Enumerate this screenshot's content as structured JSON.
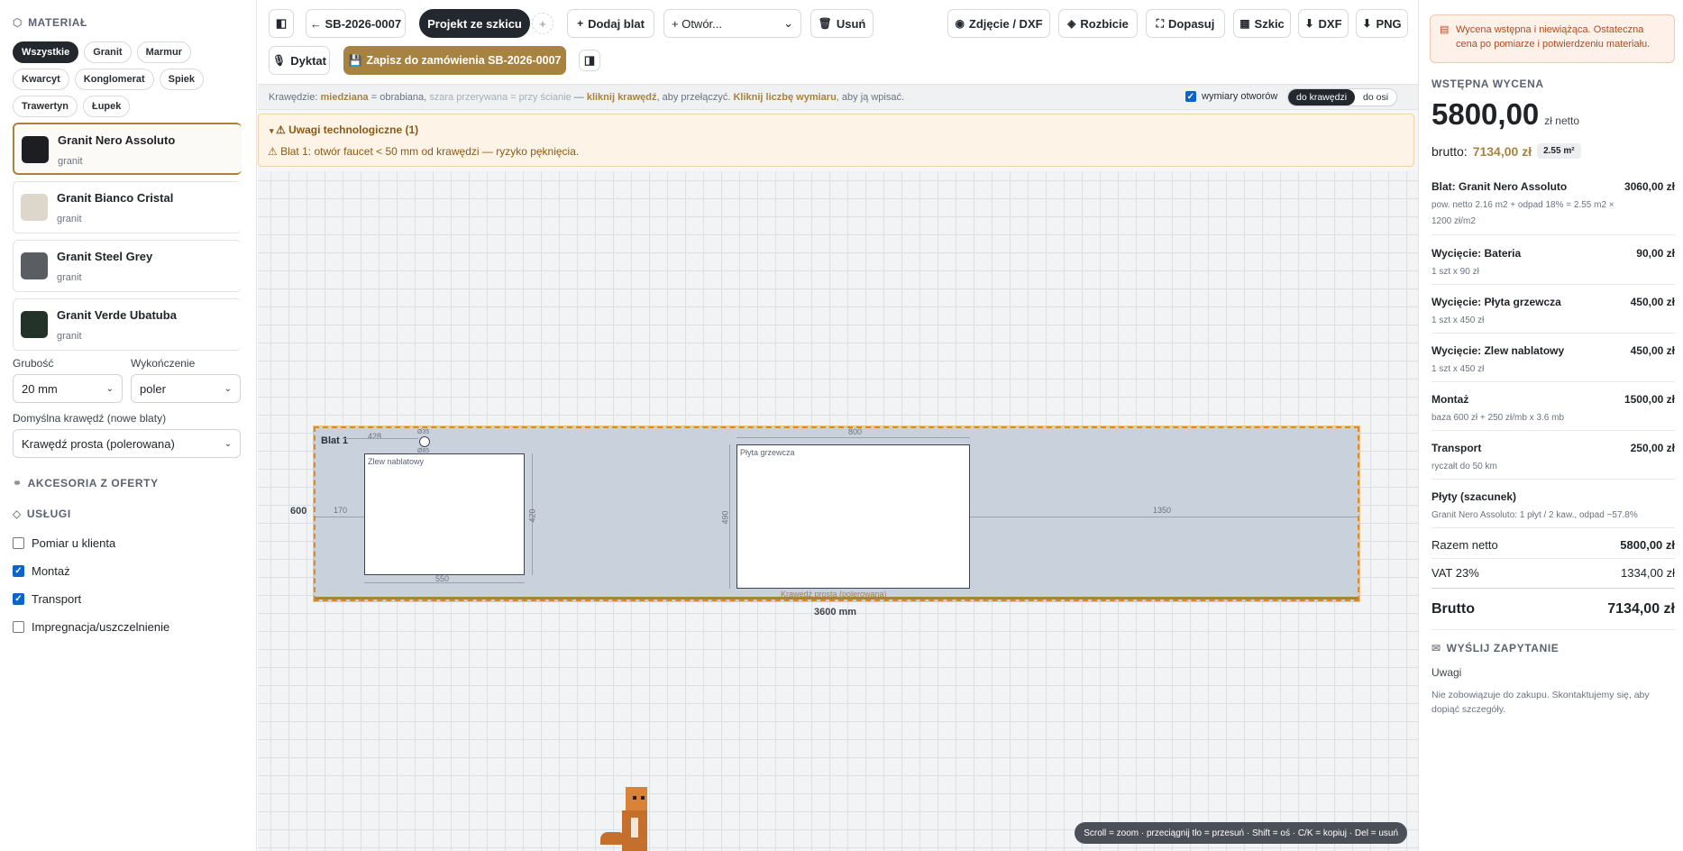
{
  "sidebar": {
    "material_heading": "MATERIAŁ",
    "chips": [
      "Wszystkie",
      "Granit",
      "Marmur",
      "Kwarcyt",
      "Konglomerat",
      "Spiek",
      "Trawertyn",
      "Łupek"
    ],
    "materials": [
      {
        "name": "Granit Nero Assoluto",
        "type": "granit",
        "color": "#1c1e21"
      },
      {
        "name": "Granit Bianco Cristal",
        "type": "granit",
        "color": "#ddd7cb"
      },
      {
        "name": "Granit Steel Grey",
        "type": "granit",
        "color": "#5a5d62"
      },
      {
        "name": "Granit Verde Ubatuba",
        "type": "granit",
        "color": "#23332a"
      }
    ],
    "thickness_label": "Grubość",
    "thickness_value": "20 mm",
    "finish_label": "Wykończenie",
    "finish_value": "poler",
    "edge_label": "Domyślna krawędź (nowe blaty)",
    "edge_value": "Krawędź prosta (polerowana)",
    "accessories_heading": "AKCESORIA Z OFERTY",
    "services_heading": "USŁUGI",
    "services": [
      {
        "label": "Pomiar u klienta",
        "checked": false
      },
      {
        "label": "Montaż",
        "checked": true
      },
      {
        "label": "Transport",
        "checked": true
      },
      {
        "label": "Impregnacja/uszczelnienie",
        "checked": false
      }
    ]
  },
  "toolbar": {
    "back_label": "← SB-2026-0007",
    "project_label": "Projekt ze szkicu",
    "add_tab": "+",
    "add_top_label": "Dodaj blat",
    "hole_select": "+ Otwór...",
    "delete_label": "Usuń",
    "photo_label": "Zdjęcie / DXF",
    "explode_label": "Rozbicie",
    "fit_label": "Dopasuj",
    "sketch_label": "Szkic",
    "dxf_label": "DXF",
    "png_label": "PNG",
    "dictate_label": "Dyktat",
    "save_label": "Zapisz do zamówienia SB-2026-0007"
  },
  "hint": {
    "p1": "Krawędzie: ",
    "mitered": "miedziana",
    "p2": " = obrabiana, ",
    "grey": "szara przerywana = przy ścianie",
    "p3": " — ",
    "click_edge": "kliknij krawędź",
    "p4": ", aby przełączyć. ",
    "click_num": "Kliknij liczbę wymiaru",
    "p5": ", aby ją wpisać.",
    "hole_dims_label": "wymiary otworów",
    "seg_edge": "do krawędzi",
    "seg_axis": "do osi"
  },
  "warnings": {
    "title": "⚠ Uwagi technologiczne (1)",
    "item": "⚠ Blat 1: otwór faucet < 50 mm od krawędzi — ryzyko pęknięcia."
  },
  "canvas": {
    "top_name": "Blat 1",
    "depth": "600",
    "length": "3600 mm",
    "edge_label": "Krawędź prosta (polerowana)",
    "sink_name": "Zlew nablatowy",
    "sink_w": "550",
    "sink_h": "420",
    "sink_left": "170",
    "faucet_x": "428",
    "faucet_t": "Ø35",
    "faucet_b": "Ø85",
    "hob_name": "Płyta grzewcza",
    "hob_w": "800",
    "hob_h": "490",
    "hob_right": "1350",
    "shortcuts": "Scroll = zoom · przeciągnij tło = przesuń · Shift = oś · C/K = kopiuj · Del = usuń"
  },
  "quote": {
    "notice": "Wycena wstępna i niewiążąca. Ostateczna cena po pomiarze i potwierdzeniu materiału.",
    "heading": "WSTĘPNA WYCENA",
    "net_big": "5800,00",
    "net_unit": "zł netto",
    "gross_label": "brutto:",
    "gross_val": "7134,00 zł",
    "area": "2.55 m²",
    "lines": [
      {
        "label": "Blat: Granit Nero Assoluto",
        "value": "3060,00 zł",
        "sub": "pow. netto 2.16 m2 + odpad 18% = 2.55 m2 × 1200 zł/m2"
      },
      {
        "label": "Wycięcie: Bateria",
        "value": "90,00 zł",
        "sub": "1 szt x 90 zł"
      },
      {
        "label": "Wycięcie: Płyta grzewcza",
        "value": "450,00 zł",
        "sub": "1 szt x 450 zł"
      },
      {
        "label": "Wycięcie: Zlew nablatowy",
        "value": "450,00 zł",
        "sub": "1 szt x 450 zł"
      },
      {
        "label": "Montaż",
        "value": "1500,00 zł",
        "sub": "baza 600 zł + 250 zł/mb x 3.6 mb"
      },
      {
        "label": "Transport",
        "value": "250,00 zł",
        "sub": "ryczałt do 50 km"
      },
      {
        "label": "Płyty (szacunek)",
        "value": "",
        "sub": "Granit Nero Assoluto: 1 płyt / 2 kaw., odpad ~57.8%"
      }
    ],
    "net_label": "Razem netto",
    "net_val": "5800,00 zł",
    "vat_label": "VAT 23%",
    "vat_val": "1334,00 zł",
    "brutto_label": "Brutto",
    "brutto_val": "7134,00 zł",
    "send_heading": "WYŚLIJ ZAPYTANIE",
    "notes_label": "Uwagi",
    "notes_text": "Nie zobowiązuje do zakupu. Skontaktujemy się, aby dopiąć szczegóły."
  }
}
